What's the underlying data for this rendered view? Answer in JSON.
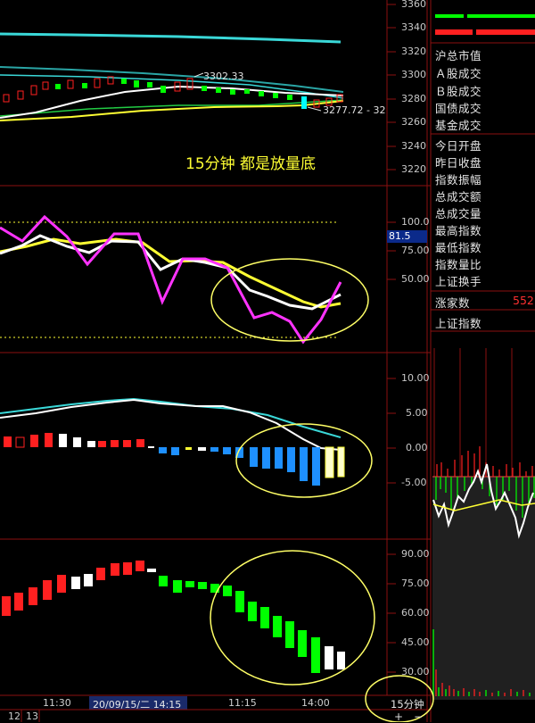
{
  "price_axis": [
    "3360",
    "3340",
    "3320",
    "3300",
    "3280",
    "3260",
    "3240",
    "3220"
  ],
  "kd_axis": [
    "100.0",
    "75.00",
    "50.00"
  ],
  "macd_axis": [
    "10.00",
    "5.00",
    "0.00",
    "-5.00"
  ],
  "rsi_axis": [
    "90.00",
    "75.00",
    "60.00",
    "45.00",
    "30.00"
  ],
  "kd_value_badge": "81.5",
  "price_labels": {
    "high": "3302.33",
    "low": "3277.72 - 32"
  },
  "annotation": "15分钟 都是放量底",
  "info_panel": {
    "header": "沪总市值",
    "items": [
      "Ａ股成交",
      "Ｂ股成交",
      "国债成交",
      "基金成交",
      "今日开盘",
      "昨日收盘",
      "指数振幅",
      "总成交额",
      "总成交量",
      "最高指数",
      "最低指数",
      "指数量比",
      "上证换手"
    ],
    "rise_label": "涨家数",
    "rise_value": "552",
    "index_label": "上证指数"
  },
  "time_axis": {
    "labels": [
      "11:30",
      "20/09/15/二 14:15",
      "11:15",
      "14:00"
    ]
  },
  "period_button": "15分钟",
  "zoom_controls": {
    "plus": "+",
    "minus": "−"
  },
  "bottom_nums": [
    "12",
    "13"
  ],
  "colors": {
    "up": "#ff2020",
    "down": "#00ff00",
    "macd_neg": "#1e90ff",
    "ma_cyan": "#3ad8d8",
    "yellow": "#ffff33",
    "magenta": "#ff33ff",
    "ellipse": "#ffff66"
  }
}
